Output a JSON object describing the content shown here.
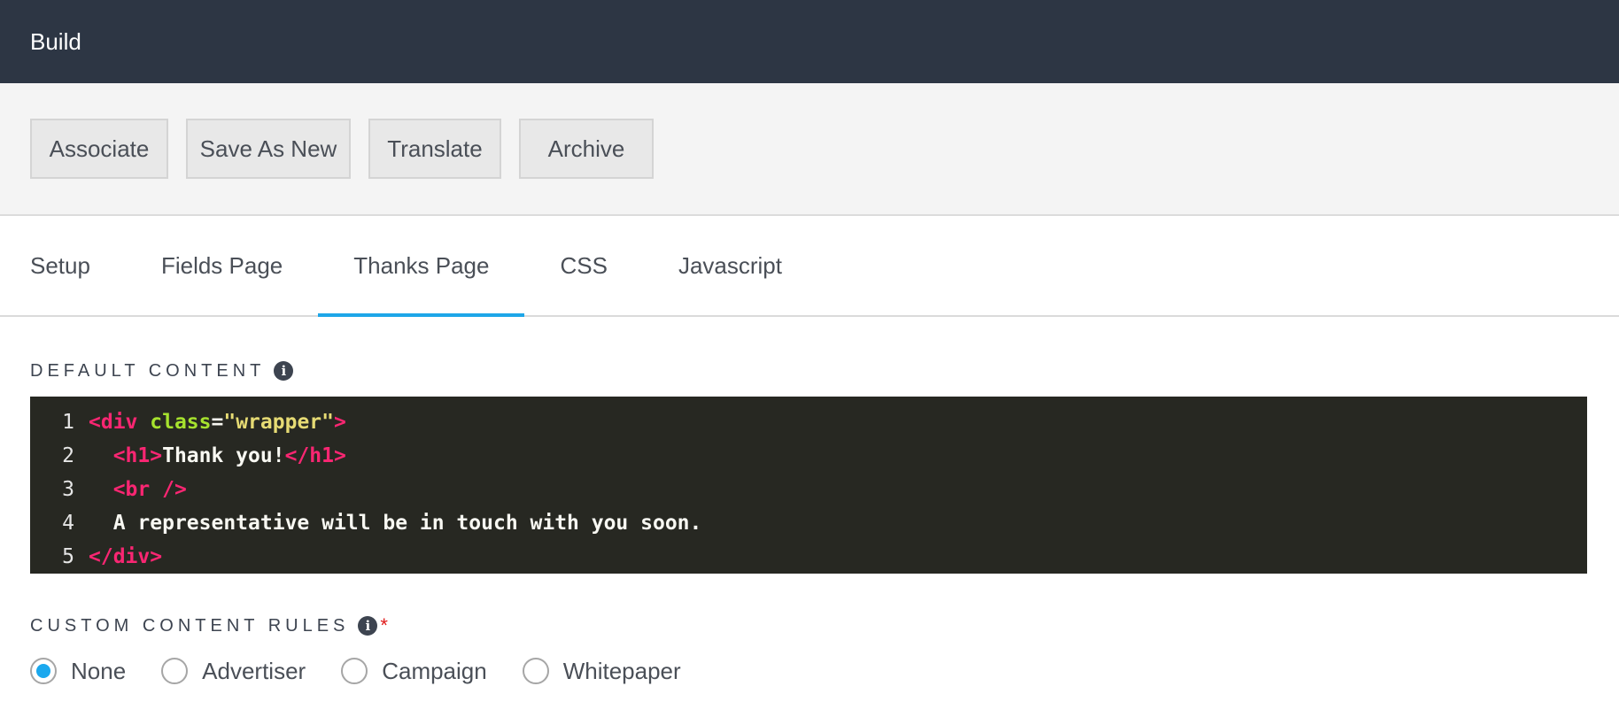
{
  "header": {
    "title": "Build"
  },
  "toolbar": {
    "buttons": [
      {
        "label": "Associate"
      },
      {
        "label": "Save As New"
      },
      {
        "label": "Translate"
      },
      {
        "label": "Archive"
      }
    ]
  },
  "tabs": [
    {
      "label": "Setup",
      "active": false
    },
    {
      "label": "Fields Page",
      "active": false
    },
    {
      "label": "Thanks Page",
      "active": true
    },
    {
      "label": "CSS",
      "active": false
    },
    {
      "label": "Javascript",
      "active": false
    }
  ],
  "default_content": {
    "label": "DEFAULT CONTENT",
    "info_icon": "info-circle-icon",
    "line_numbers": [
      "1",
      "2",
      "3",
      "4",
      "5"
    ],
    "code": [
      {
        "open": "<div",
        "attr": "class",
        "eq": "=",
        "value": "\"wrapper\"",
        "close": ">"
      },
      {
        "indent": "  ",
        "open": "<h1>",
        "text": "Thank you!",
        "close": "</h1>"
      },
      {
        "indent": "  ",
        "tag": "<br />"
      },
      {
        "indent": "  ",
        "text": "A representative will be in touch with you soon."
      },
      {
        "tag": "</div>"
      }
    ]
  },
  "custom_rules": {
    "label": "CUSTOM CONTENT RULES",
    "info_icon": "info-circle-icon",
    "required_mark": "*",
    "options": [
      {
        "label": "None",
        "checked": true
      },
      {
        "label": "Advertiser",
        "checked": false
      },
      {
        "label": "Campaign",
        "checked": false
      },
      {
        "label": "Whitepaper",
        "checked": false
      }
    ]
  },
  "colors": {
    "header_bg": "#2d3644",
    "accent": "#1da6e8",
    "editor_bg": "#272822",
    "required": "#e01b1b"
  }
}
